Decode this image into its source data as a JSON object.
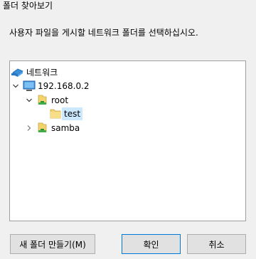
{
  "window": {
    "title": "폴더 찾아보기"
  },
  "description": "사용자 파일을 게시할 네트워크 폴더를 선택하십시오.",
  "tree": {
    "network_label": "네트워크",
    "host_label": "192.168.0.2",
    "root_label": "root",
    "test_label": "test",
    "samba_label": "samba",
    "selected": "test"
  },
  "buttons": {
    "new_folder": "새 폴더 만들기(M)",
    "ok": "확인",
    "cancel": "취소"
  },
  "colors": {
    "selection": "#cce8ff",
    "folder": "#f3d36e",
    "primary_border": "#0078d7"
  }
}
